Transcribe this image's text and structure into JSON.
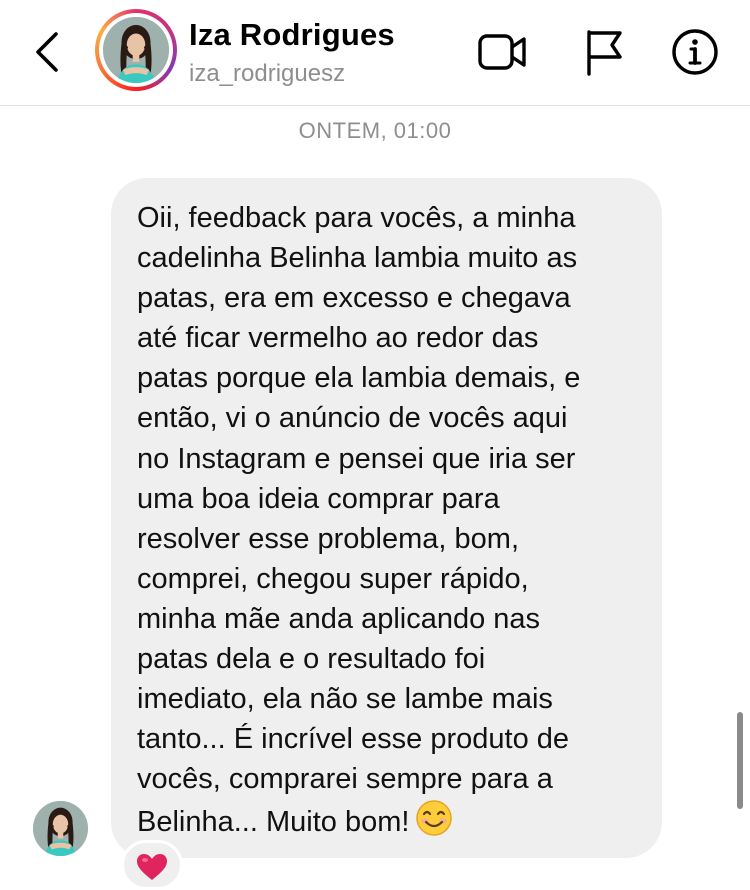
{
  "header": {
    "user_name": "Iza Rodrigues",
    "username": "iza_rodriguesz",
    "icons": [
      "back-chevron-icon",
      "video-call-icon",
      "report-flag-icon",
      "info-icon"
    ]
  },
  "conversation": {
    "timestamp": "ONTEM, 01:00",
    "message": {
      "text": "Oii, feedback para vocês, a minha\ncadelinha Belinha lambia muito as\npatas, era em excesso e chegava\naté ficar vermelho ao redor das\npatas porque ela lambia demais, e\nentão, vi o anúncio de vocês aqui\nno Instagram e pensei que iria ser\numa boa ideia comprar para\nresolver esse problema, bom,\ncomprei, chegou super rápido,\nminha mãe anda aplicando nas\npatas dela e o resultado foi\nimediato, ela não se lambe mais\ntanto... É incrível esse produto de\nvocês, comprarei sempre para a\nBelinha... Muito bom!",
      "emoji": "smiling-face-icon",
      "reaction": "red-heart-icon"
    }
  },
  "colors": {
    "bubble": "#efefef",
    "secondary_text": "#8e8e8e",
    "heart": "#e0245e"
  }
}
